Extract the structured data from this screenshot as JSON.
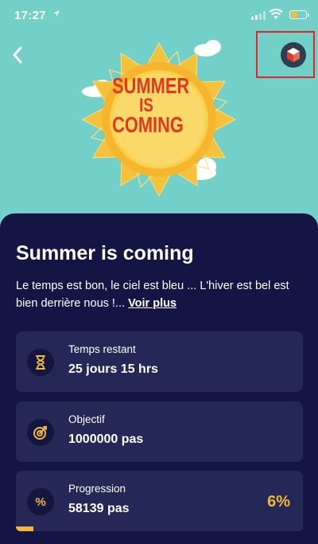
{
  "status_bar": {
    "time": "17:27"
  },
  "hero": {
    "line1": "SUMMER",
    "line2": "IS",
    "line3": "COMING"
  },
  "challenge": {
    "title": "Summer is coming",
    "description": "Le temps est bon, le ciel est bleu ... L'hiver est bel est bien derrière nous !...",
    "more_link": "Voir plus"
  },
  "stats": [
    {
      "label": "Temps restant",
      "value": "25 jours 15 hrs",
      "icon": "hourglass-icon"
    },
    {
      "label": "Objectif",
      "value": "1000000 pas",
      "icon": "target-icon"
    },
    {
      "label": "Progression",
      "value": "58139 pas",
      "percent": "6%",
      "progress_fraction": 0.06,
      "icon": "percent-icon"
    }
  ],
  "colors": {
    "accent": "#f3b73a",
    "panel": "#151545",
    "card": "#252756",
    "sky": "#72d0c8",
    "highlight": "#e1252d"
  }
}
